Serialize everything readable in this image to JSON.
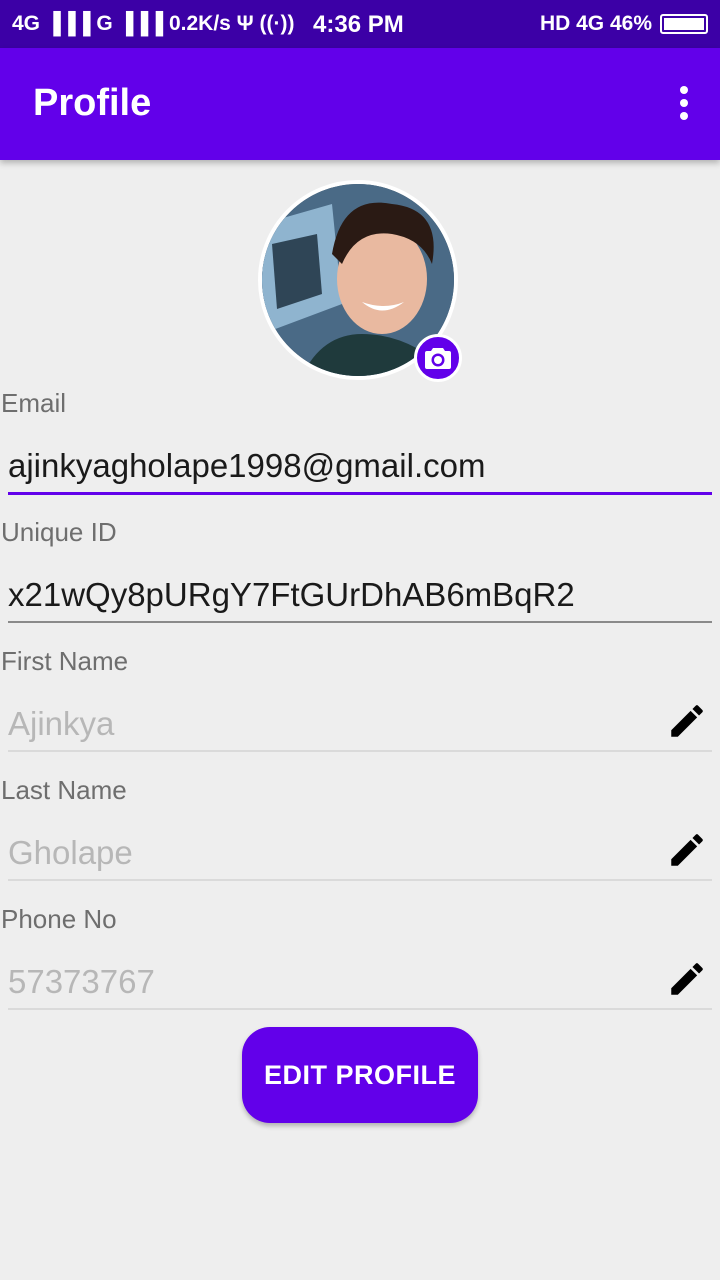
{
  "status_bar": {
    "left": "4G ▐▐▐ G ▐▐▐ 0.2K/s Ψ ((·))",
    "time": "4:36 PM",
    "right": "HD 4G 46%"
  },
  "app_bar": {
    "title": "Profile"
  },
  "profile": {
    "email_label": "Email",
    "email_value": "ajinkyagholape1998@gmail.com",
    "uid_label": "Unique ID",
    "uid_value": "x21wQy8pURgY7FtGUrDhAB6mBqR2",
    "first_name_label": "First Name",
    "first_name_hint": "Ajinkya",
    "last_name_label": "Last Name",
    "last_name_hint": "Gholape",
    "phone_label": "Phone No",
    "phone_hint": "57373767"
  },
  "actions": {
    "edit_profile": "EDIT PROFILE"
  },
  "colors": {
    "primary": "#6200ea",
    "status_bar": "#3c00a6",
    "background": "#eeeeee"
  },
  "icons": {
    "overflow": "more-vert-icon",
    "camera": "camera-icon",
    "edit": "pencil-icon"
  }
}
